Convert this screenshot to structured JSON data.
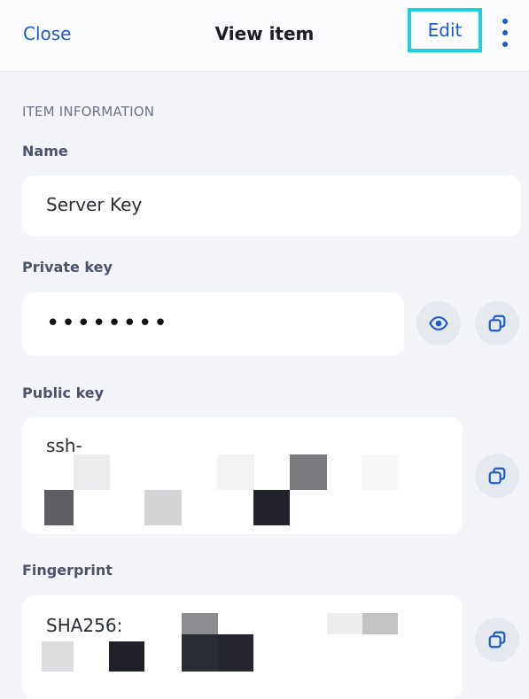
{
  "header": {
    "close_label": "Close",
    "title": "View item",
    "edit_label": "Edit",
    "more_icon": "more-vertical-icon"
  },
  "section": {
    "title": "ITEM INFORMATION"
  },
  "fields": {
    "name": {
      "label": "Name",
      "value": "Server Key"
    },
    "private_key": {
      "label": "Private key",
      "value": "••••••••",
      "reveal_icon": "eye-icon",
      "copy_icon": "copy-icon"
    },
    "public_key": {
      "label": "Public key",
      "value": "ssh-",
      "copy_icon": "copy-icon"
    },
    "fingerprint": {
      "label": "Fingerprint",
      "value": "SHA256:",
      "copy_icon": "copy-icon"
    }
  },
  "colors": {
    "accent": "#1f5ac7",
    "highlight": "#1ed0df",
    "background": "#f3f5f9",
    "card": "#ffffff"
  }
}
